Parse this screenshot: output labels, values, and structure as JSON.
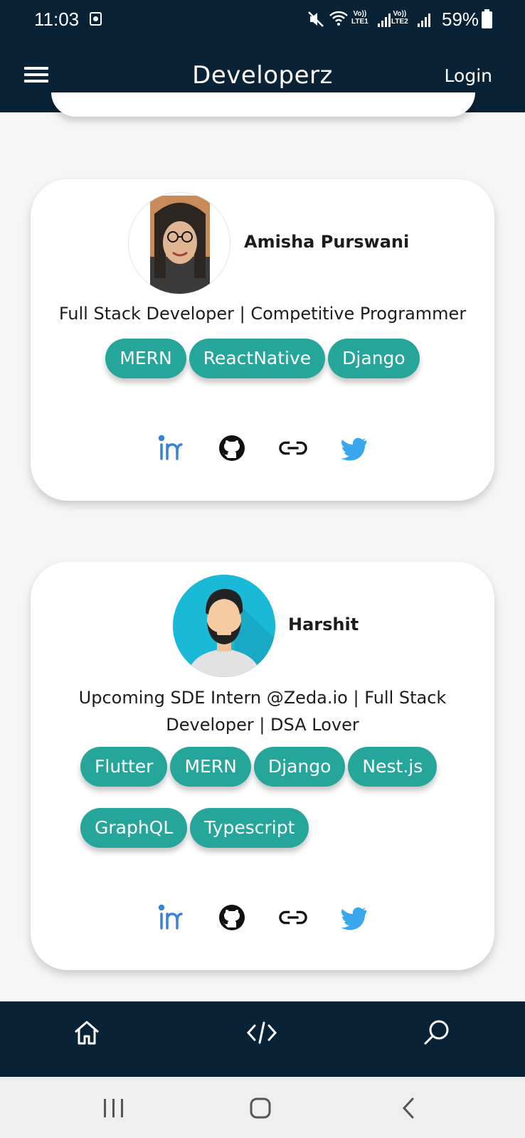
{
  "status_bar": {
    "time": "11:03",
    "net1": "Vo))\nLTE1",
    "net2": "Vo))\nLTE2",
    "battery": "59%"
  },
  "app_bar": {
    "title": "Developerz",
    "login": "Login"
  },
  "developers": [
    {
      "name": "Amisha Purswani",
      "bio": "Full Stack Developer | Competitive Programmer",
      "skills": [
        "MERN",
        "ReactNative",
        "Django"
      ]
    },
    {
      "name": "Harshit",
      "bio": "Upcoming SDE Intern @Zeda.io | Full Stack Developer | DSA Lover",
      "skills": [
        "Flutter",
        "MERN",
        "Django",
        "Nest.js",
        "GraphQL",
        "Typescript"
      ]
    }
  ],
  "social_icons": [
    "linkedin-icon",
    "github-icon",
    "link-icon",
    "twitter-icon"
  ],
  "bottom_nav": [
    "home-icon",
    "code-icon",
    "search-icon"
  ],
  "colors": {
    "header": "#0a2236",
    "chip": "#26a69a",
    "linkedin": "#3b82d6",
    "twitter": "#3aa6ec"
  }
}
